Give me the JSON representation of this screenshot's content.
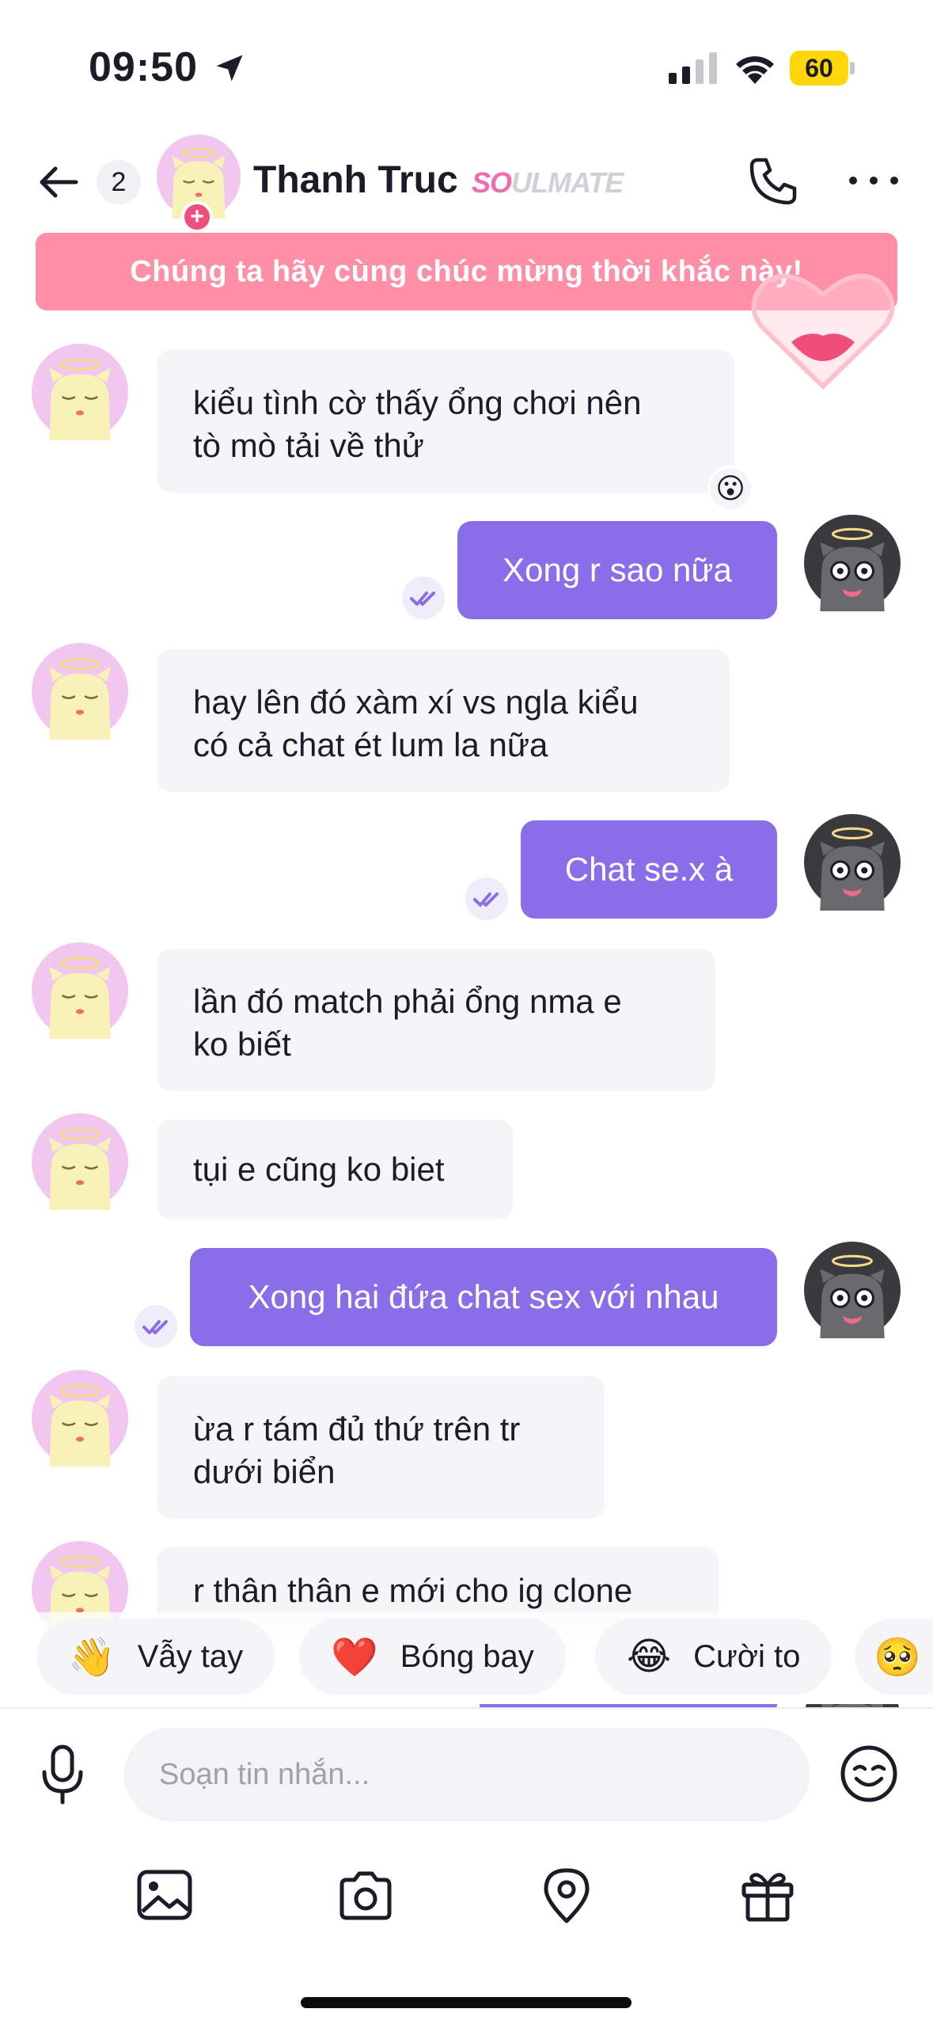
{
  "status_bar": {
    "time": "09:50",
    "battery": "60"
  },
  "header": {
    "unread_count": "2",
    "contact_name": "Thanh Truc",
    "badge_prefix": "SO",
    "badge_suffix": "ULMATE",
    "plus": "+"
  },
  "banner": {
    "text": "Chúng ta hãy cùng chúc mừng thời khắc này!"
  },
  "messages": [
    {
      "direction": "in",
      "text": "kiểu tình cờ thấy ổng chơi nên\ntò mò tải về thử",
      "reaction": "😮"
    },
    {
      "direction": "out",
      "text": "Xong r sao nữa"
    },
    {
      "direction": "in",
      "text": "hay lên đó xàm xí vs ngla kiểu\ncó cả chat ét lum la nữa"
    },
    {
      "direction": "out",
      "text": "Chat se.x à"
    },
    {
      "direction": "in",
      "text": "lần đó match phải ổng nma e\nko biết"
    },
    {
      "direction": "in",
      "text": "tụi e cũng ko biet"
    },
    {
      "direction": "out",
      "text": "Xong hai đứa chat sex với nhau"
    },
    {
      "direction": "in",
      "text": "ừa r tám đủ thứ trên tr\ndưới biển"
    },
    {
      "direction": "in",
      "text": "r thân thân e mới cho ig clone"
    }
  ],
  "quick_replies": [
    {
      "emoji": "👋",
      "label": "Vẫy tay"
    },
    {
      "emoji": "❤️",
      "label": "Bóng bay"
    },
    {
      "emoji": "😂",
      "label": "Cười to"
    },
    {
      "emoji": "🥺",
      "label": ""
    }
  ],
  "composer": {
    "placeholder": "Soạn tin nhắn..."
  },
  "icons": {
    "back": "back-arrow-icon",
    "phone": "phone-icon",
    "more": "more-icon",
    "mic": "mic-icon",
    "emoji": "emoji-icon",
    "gallery": "gallery-icon",
    "camera": "camera-icon",
    "location": "location-icon",
    "gift": "gift-icon"
  },
  "colors": {
    "outgoing": "#8a6de9",
    "incoming": "#f5f5f7",
    "banner": "#ff8fa6",
    "accent_pink": "#ef4f7d"
  }
}
